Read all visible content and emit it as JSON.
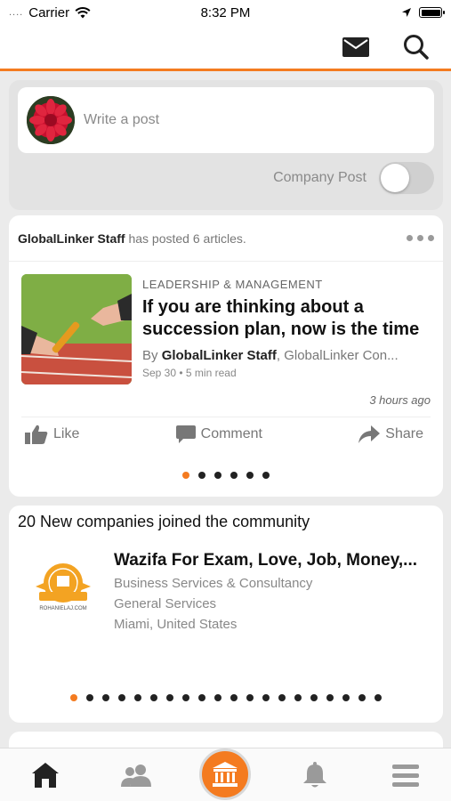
{
  "status_bar": {
    "signal": "....",
    "carrier": "Carrier",
    "time": "8:32 PM"
  },
  "header": {
    "icons": [
      "mail-icon",
      "search-icon"
    ]
  },
  "composer": {
    "placeholder": "Write a post",
    "company_post_label": "Company Post",
    "company_post_on": false
  },
  "article_card": {
    "poster": "GlobalLinker Staff",
    "poster_suffix": "has posted 6 articles.",
    "category": "LEADERSHIP & MANAGEMENT",
    "headline": "If you are thinking about a succession plan, now is the time",
    "by_prefix": "By",
    "author": "GlobalLinker Staff",
    "org": "GlobalLinker Con...",
    "date": "Sep 30",
    "read_time": "• 5 min read",
    "posted_ago": "3 hours ago",
    "actions": {
      "like": "Like",
      "comment": "Comment",
      "share": "Share"
    },
    "pager_total": 6,
    "pager_active": 0
  },
  "companies_card": {
    "title": "20 New companies joined the community",
    "company": {
      "name": "Wazifa For Exam, Love, Job, Money,...",
      "category": "Business Services & Consultancy",
      "subcategory": "General Services",
      "location": "Miami, United States",
      "logo_text": "ROHANIELAJ.COM"
    },
    "pager_total": 20,
    "pager_active": 0
  },
  "bottom_nav": {
    "items": [
      "home-icon",
      "people-icon",
      "institution-icon",
      "bell-icon",
      "menu-icon"
    ],
    "active": "home-icon"
  },
  "colors": {
    "accent": "#f47b20",
    "background": "#ebebeb"
  }
}
